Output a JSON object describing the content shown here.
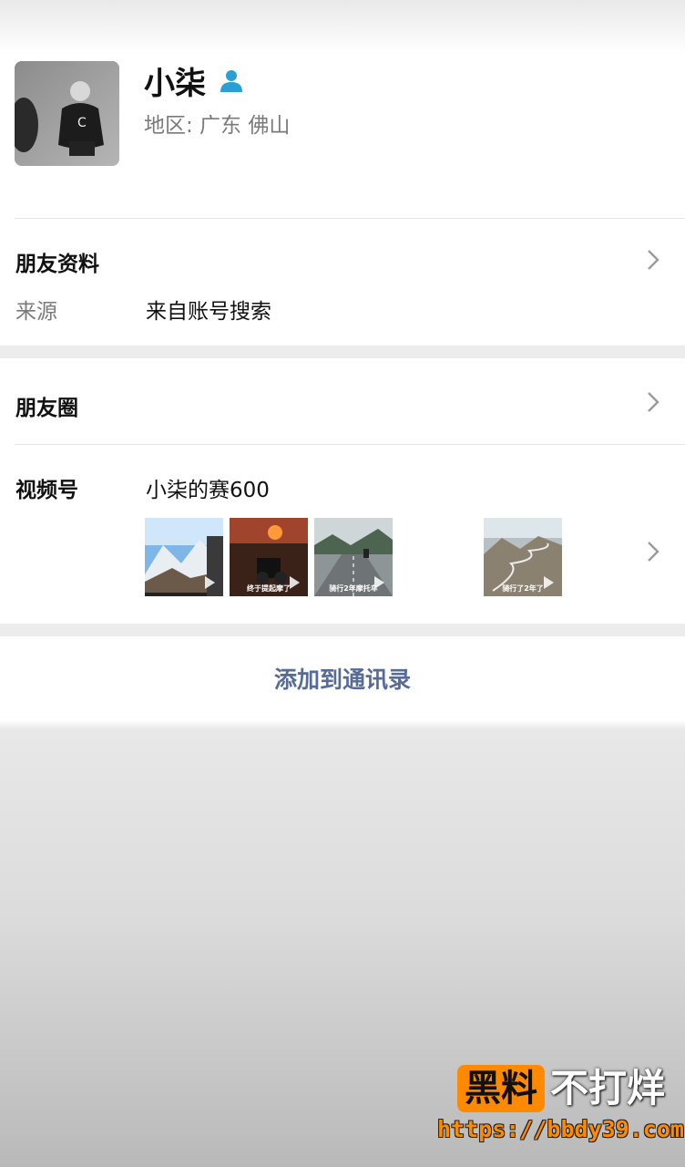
{
  "profile": {
    "name": "小柒",
    "region": "地区: 广东 佛山",
    "verified_icon": "person-icon",
    "accent_color": "#1aad19"
  },
  "info": {
    "title": "朋友资料",
    "source_label": "来源",
    "source_value": "来自账号搜索"
  },
  "moments": {
    "title": "朋友圈"
  },
  "channels": {
    "label": "视频号",
    "value": "小柒的赛600",
    "thumbnails": [
      {
        "caption": ""
      },
      {
        "caption": "终于提起摩了"
      },
      {
        "caption": "骑行2年摩托车"
      },
      {
        "caption": "骑行了2年了"
      }
    ]
  },
  "actions": {
    "add_contact": "添加到通讯录",
    "link_color": "#576b95"
  },
  "watermark": {
    "box_text": "黑料",
    "text": "不打烊",
    "url": "https://bbdy39.com"
  }
}
